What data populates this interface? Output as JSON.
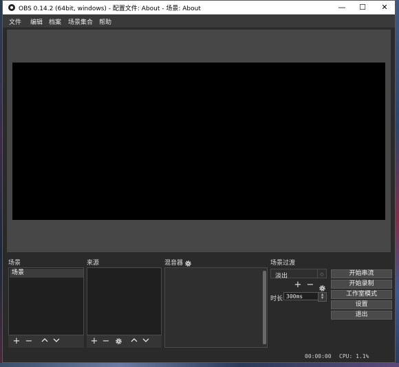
{
  "window": {
    "title": "OBS 0.14.2 (64bit, windows) - 配置文件: About - 场景: About",
    "minimize": "—",
    "maximize": "☐",
    "close": "✕"
  },
  "menu": [
    "文件",
    "编辑",
    "档案",
    "场景集合",
    "帮助"
  ],
  "scenes": {
    "label": "场景",
    "items": [
      "场景"
    ]
  },
  "sources": {
    "label": "来源"
  },
  "mixer": {
    "label": "混音器"
  },
  "transitions": {
    "label": "场景过渡",
    "selected": "淡出",
    "duration_label": "时长",
    "duration_value": "300ms"
  },
  "controls": {
    "start_streaming": "开始串流",
    "start_recording": "开始录制",
    "studio_mode": "工作室模式",
    "settings": "设置",
    "exit": "退出"
  },
  "status": {
    "time": "00:00:00",
    "cpu": "CPU: 1.1%"
  },
  "colors": {
    "window_bg": "#2a2a2a",
    "preview_bg": "#474747",
    "canvas": "#000000",
    "list_bg": "#1f1f1f",
    "button_bg": "#4a4a4a"
  },
  "icons": [
    "add-icon",
    "remove-icon",
    "move-up-icon",
    "move-down-icon",
    "gear-icon"
  ]
}
